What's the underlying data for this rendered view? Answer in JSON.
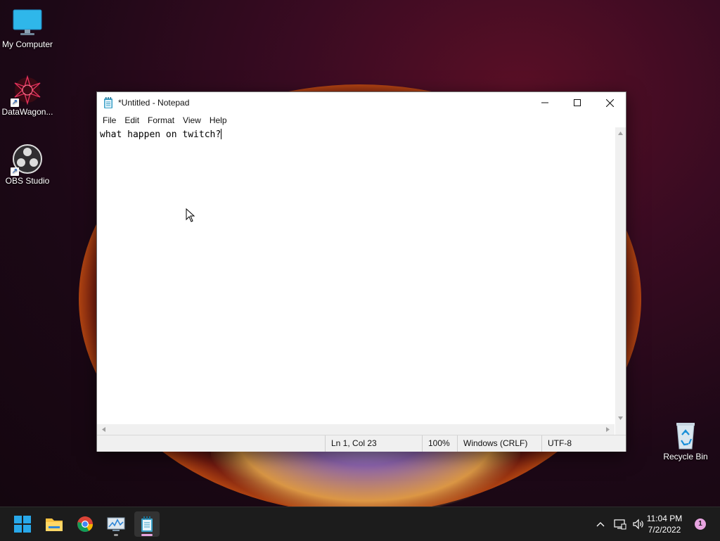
{
  "desktop": {
    "icons": [
      {
        "label": "My Computer",
        "icon": "monitor-icon"
      },
      {
        "label": "DataWagon...",
        "icon": "datawagon-icon"
      },
      {
        "label": "OBS Studio",
        "icon": "obs-icon"
      },
      {
        "label": "Recycle Bin",
        "icon": "recycle-bin-icon"
      }
    ]
  },
  "notepad": {
    "title": "*Untitled - Notepad",
    "menu": [
      "File",
      "Edit",
      "Format",
      "View",
      "Help"
    ],
    "text": "what happen on twitch?",
    "status": {
      "position": "Ln 1, Col 23",
      "zoom": "100%",
      "line_ending": "Windows (CRLF)",
      "encoding": "UTF-8"
    }
  },
  "taskbar": {
    "apps": [
      "start-icon",
      "file-explorer-icon",
      "chrome-icon",
      "task-manager-icon",
      "notepad-icon"
    ],
    "active_app": "notepad-icon",
    "clock": {
      "time": "11:04 PM",
      "date": "7/2/2022"
    },
    "notification_count": "1"
  },
  "colors": {
    "accent": "#0078d4",
    "taskbar": "#1c1c1c",
    "active_indicator": "#e7a4e0"
  }
}
